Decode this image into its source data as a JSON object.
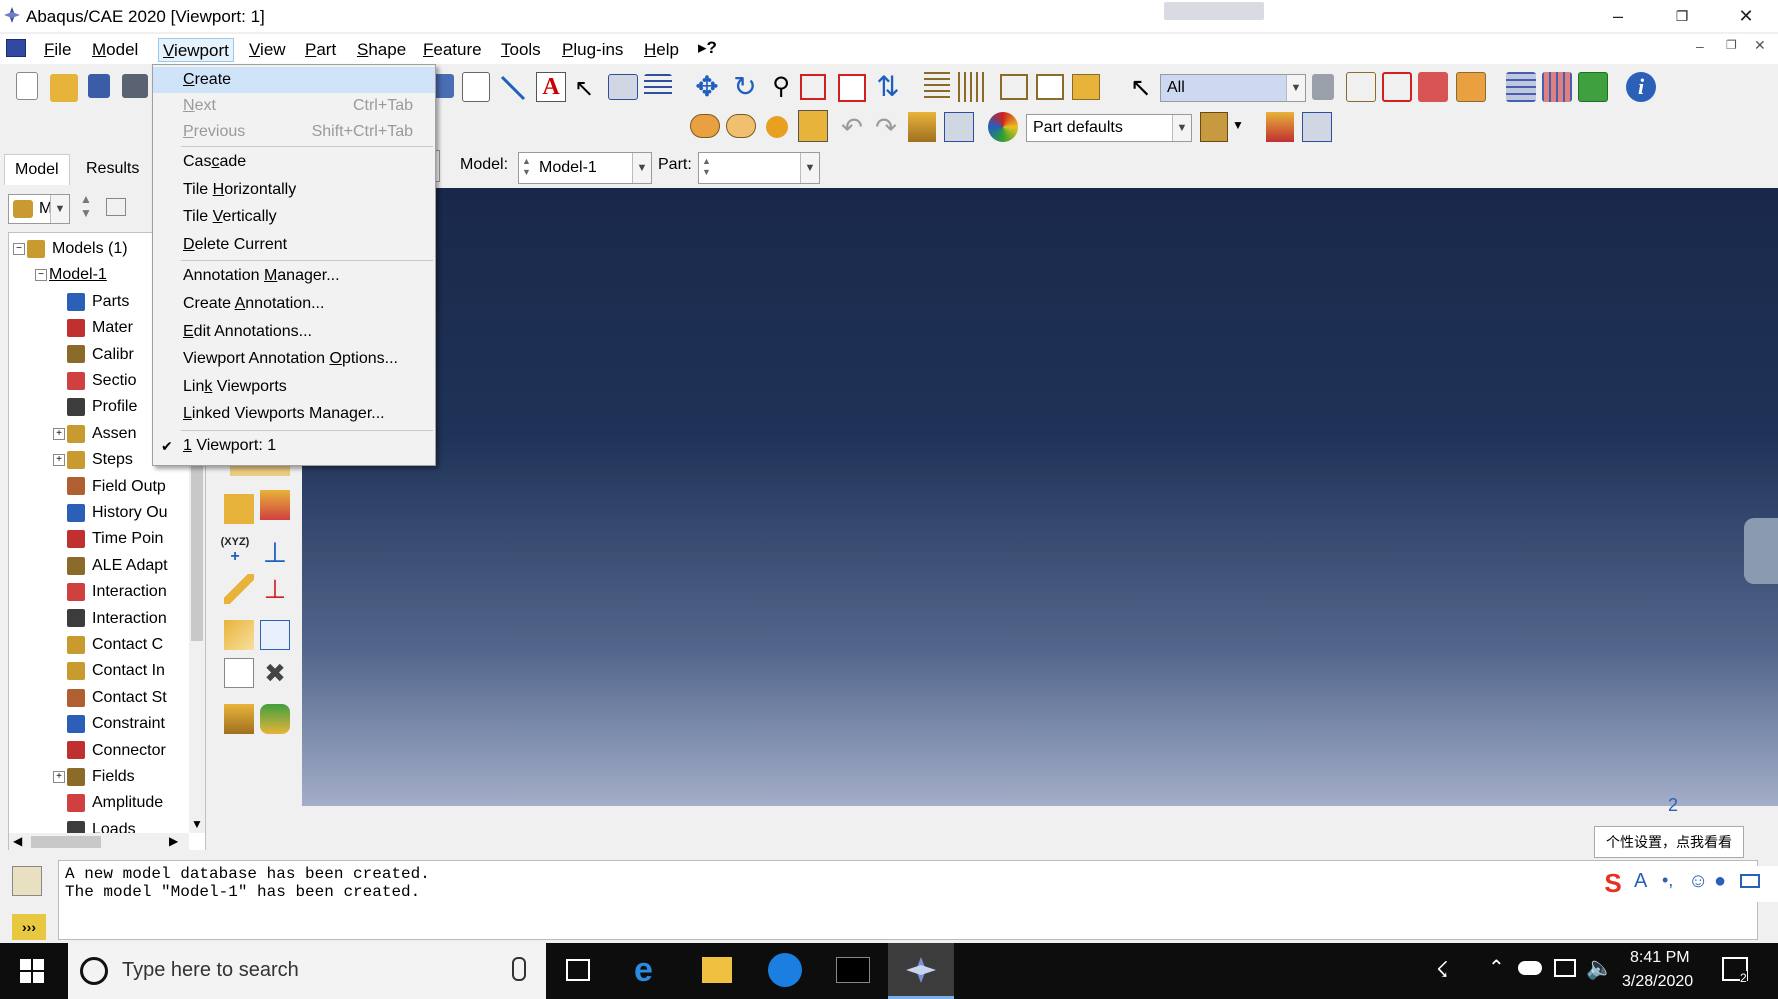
{
  "window": {
    "title": "Abaqus/CAE 2020 [Viewport: 1]"
  },
  "menubar": {
    "items": [
      {
        "label": "File",
        "u": "F",
        "rest": "ile"
      },
      {
        "label": "Model",
        "u": "M",
        "rest": "odel"
      },
      {
        "label": "Viewport",
        "u": "V",
        "rest": "iewport"
      },
      {
        "label": "View",
        "u": "V",
        "rest": "iew"
      },
      {
        "label": "Part",
        "u": "P",
        "rest": "art"
      },
      {
        "label": "Shape",
        "u": "S",
        "rest": "hape"
      },
      {
        "label": "Feature",
        "u": "F",
        "rest": "eature"
      },
      {
        "label": "Tools",
        "u": "T",
        "rest": "ools"
      },
      {
        "label": "Plug-ins",
        "u": "P",
        "rest": "lug-ins"
      },
      {
        "label": "Help",
        "u": "H",
        "rest": "elp"
      }
    ],
    "whatsthis": "▸?"
  },
  "toolbar": {
    "selection_filter": "All",
    "render_style": "Part defaults"
  },
  "context": {
    "model_label": "Model:",
    "model_value": "Model-1",
    "part_label": "Part:",
    "part_value": ""
  },
  "leftpanel": {
    "tabs": [
      "Model",
      "Results"
    ],
    "model_combo": "M"
  },
  "tree": [
    {
      "label": "Models (1)",
      "level": 0,
      "expander": "−"
    },
    {
      "label": "Model-1",
      "level": 1,
      "expander": "−"
    },
    {
      "label": "Parts",
      "level": 2
    },
    {
      "label": "Mater",
      "level": 2
    },
    {
      "label": "Calibr",
      "level": 2
    },
    {
      "label": "Sectio",
      "level": 2
    },
    {
      "label": "Profile",
      "level": 2
    },
    {
      "label": "Assen",
      "level": 2,
      "expander": "+"
    },
    {
      "label": "Steps",
      "level": 2,
      "expander": "+"
    },
    {
      "label": "Field Outp",
      "level": 2
    },
    {
      "label": "History Ou",
      "level": 2
    },
    {
      "label": "Time Poin",
      "level": 2
    },
    {
      "label": "ALE Adapt",
      "level": 2
    },
    {
      "label": "Interaction",
      "level": 2
    },
    {
      "label": "Interaction",
      "level": 2
    },
    {
      "label": "Contact C",
      "level": 2
    },
    {
      "label": "Contact In",
      "level": 2
    },
    {
      "label": "Contact St",
      "level": 2
    },
    {
      "label": "Constraint",
      "level": 2
    },
    {
      "label": "Connector",
      "level": 2
    },
    {
      "label": "Fields",
      "level": 2,
      "expander": "+"
    },
    {
      "label": "Amplitude",
      "level": 2
    },
    {
      "label": "Loads",
      "level": 2
    }
  ],
  "dropdown": {
    "items": [
      {
        "pre": "",
        "u": "C",
        "post": "reate",
        "shortcut": "",
        "disabled": false,
        "hl": true
      },
      {
        "pre": "",
        "u": "N",
        "post": "ext",
        "shortcut": "Ctrl+Tab",
        "disabled": true
      },
      {
        "pre": "",
        "u": "P",
        "post": "revious",
        "shortcut": "Shift+Ctrl+Tab",
        "disabled": true
      },
      {
        "pre": "Cas",
        "u": "c",
        "post": "ade",
        "shortcut": "",
        "disabled": false,
        "sep_before": true
      },
      {
        "pre": "Tile ",
        "u": "H",
        "post": "orizontally",
        "shortcut": "",
        "disabled": false
      },
      {
        "pre": "Tile ",
        "u": "V",
        "post": "ertically",
        "shortcut": "",
        "disabled": false
      },
      {
        "pre": "",
        "u": "D",
        "post": "elete Current",
        "shortcut": "",
        "disabled": false
      },
      {
        "pre": "Annotation ",
        "u": "M",
        "post": "anager...",
        "shortcut": "",
        "disabled": false,
        "sep_before": true
      },
      {
        "pre": "Create ",
        "u": "A",
        "post": "nnotation...",
        "shortcut": "",
        "disabled": false
      },
      {
        "pre": "",
        "u": "E",
        "post": "dit Annotations...",
        "shortcut": "",
        "disabled": false
      },
      {
        "pre": "Viewport Annotation ",
        "u": "O",
        "post": "ptions...",
        "shortcut": "",
        "disabled": false
      },
      {
        "pre": "Lin",
        "u": "k",
        "post": " Viewports",
        "shortcut": "",
        "disabled": false
      },
      {
        "pre": "",
        "u": "L",
        "post": "inked Viewports Manager...",
        "shortcut": "",
        "disabled": false
      },
      {
        "pre": "",
        "u": "1",
        "post": " Viewport: 1",
        "shortcut": "",
        "disabled": false,
        "sep_before": true,
        "checked": true
      }
    ]
  },
  "messages": {
    "line1": "A new model database has been created.",
    "line2": "The model \"Model-1\" has been created."
  },
  "ime": {
    "tooltip": "个性设置，点我看看"
  },
  "taskbar": {
    "search_placeholder": "Type here to search",
    "time": "8:41 PM",
    "date": "3/28/2020",
    "notification_count": "2"
  },
  "colors": {
    "accent": "#e5f1fb",
    "viewport_top": "#19284a",
    "viewport_bottom": "#a3aec8"
  }
}
